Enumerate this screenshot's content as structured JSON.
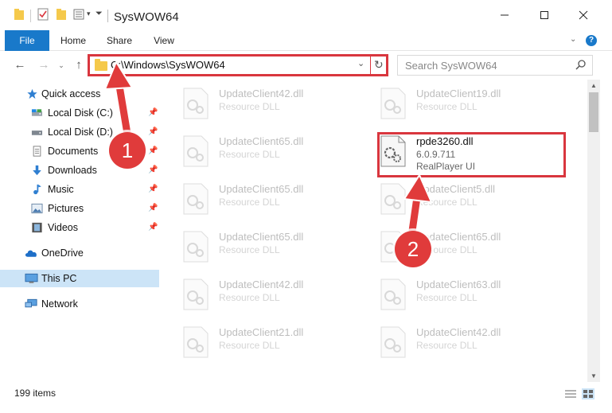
{
  "window": {
    "title": "SysWOW64",
    "controls": {
      "minimize_icon": "minimize-icon",
      "maximize_icon": "maximize-icon",
      "close_icon": "close-icon"
    }
  },
  "ribbon": {
    "tabs": [
      {
        "label": "File"
      },
      {
        "label": "Home"
      },
      {
        "label": "Share"
      },
      {
        "label": "View"
      }
    ]
  },
  "address": {
    "path": "C:\\Windows\\SysWOW64"
  },
  "search": {
    "placeholder": "Search SysWOW64"
  },
  "nav": {
    "items": [
      {
        "label": "Quick access",
        "icon": "star-icon"
      },
      {
        "label": "Local Disk (C:)",
        "icon": "drive-icon"
      },
      {
        "label": "Local Disk (D:)",
        "icon": "drive-icon"
      },
      {
        "label": "Documents",
        "icon": "documents-icon"
      },
      {
        "label": "Downloads",
        "icon": "downloads-icon"
      },
      {
        "label": "Music",
        "icon": "music-icon"
      },
      {
        "label": "Pictures",
        "icon": "pictures-icon"
      },
      {
        "label": "Videos",
        "icon": "videos-icon"
      },
      {
        "label": "OneDrive",
        "icon": "cloud-icon"
      },
      {
        "label": "This PC",
        "icon": "computer-icon"
      },
      {
        "label": "Network",
        "icon": "network-icon"
      }
    ]
  },
  "files": [
    {
      "name": "UpdateClient42.dll",
      "type": "Resource DLL"
    },
    {
      "name": "UpdateClient19.dll",
      "type": "Resource DLL"
    },
    {
      "name": "UpdateClient65.dll",
      "type": "Resource DLL"
    },
    {
      "name": "rpde3260.dll",
      "version": "6.0.9.711",
      "type": "RealPlayer UI"
    },
    {
      "name": "UpdateClient65.dll",
      "type": "Resource DLL"
    },
    {
      "name": "UpdateClient5.dll",
      "type": "Resource DLL"
    },
    {
      "name": "UpdateClient65.dll",
      "type": "Resource DLL"
    },
    {
      "name": "UpdateClient65.dll",
      "type": "Resource DLL"
    },
    {
      "name": "UpdateClient42.dll",
      "type": "Resource DLL"
    },
    {
      "name": "UpdateClient63.dll",
      "type": "Resource DLL"
    },
    {
      "name": "UpdateClient21.dll",
      "type": "Resource DLL"
    },
    {
      "name": "UpdateClient42.dll",
      "type": "Resource DLL"
    }
  ],
  "status": {
    "item_count": "199 items"
  },
  "callouts": {
    "one": "1",
    "two": "2",
    "color": "#e03b3b"
  },
  "colors": {
    "accent": "#1979ca",
    "highlight_border": "#d9363e",
    "selected_nav": "#cce4f7"
  }
}
